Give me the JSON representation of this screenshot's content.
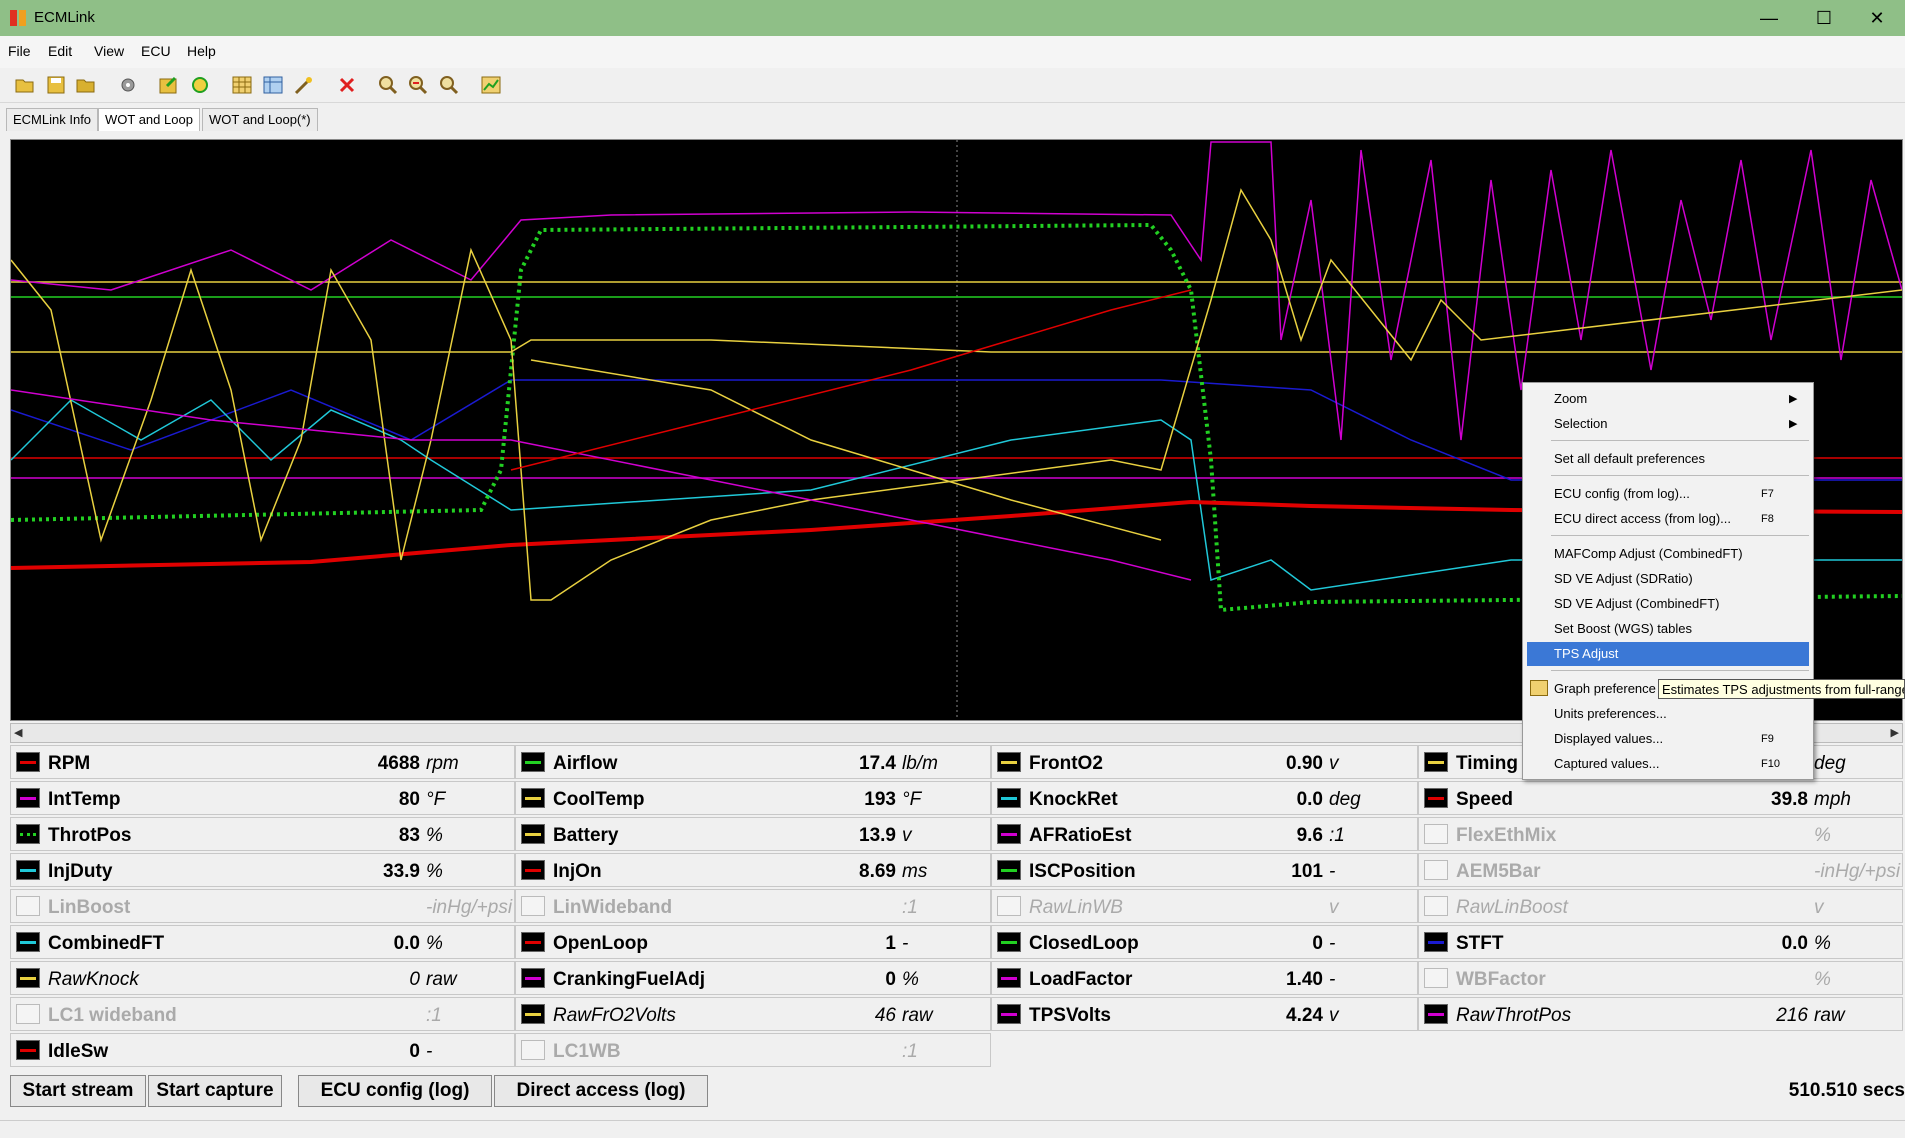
{
  "window": {
    "title": "ECMLink",
    "minimize": "—",
    "maximize": "☐",
    "close": "✕"
  },
  "menu": [
    "File",
    "Edit",
    "View",
    "ECU",
    "Help"
  ],
  "tabs": [
    "ECMLink Info",
    "WOT and Loop",
    "WOT and Loop(*)"
  ],
  "context_menu": {
    "zoom": "Zoom",
    "selection": "Selection",
    "set_defaults": "Set all default preferences",
    "ecu_config": "ECU config (from log)...",
    "ecu_config_key": "F7",
    "ecu_direct": "ECU direct access (from log)...",
    "ecu_direct_key": "F8",
    "mafcomp": "MAFComp Adjust (CombinedFT)",
    "sdve_ratio": "SD VE Adjust (SDRatio)",
    "sdve_combined": "SD VE Adjust (CombinedFT)",
    "set_boost": "Set Boost (WGS) tables",
    "tps_adjust": "TPS Adjust",
    "graph_prefs": "Graph preference",
    "units_prefs": "Units preferences...",
    "displayed_values": "Displayed values...",
    "displayed_values_key": "F9",
    "captured_values": "Captured values...",
    "captured_values_key": "F10",
    "tooltip": "Estimates TPS adjustments from full-range"
  },
  "colors": {
    "red": "#e00000",
    "magenta": "#d000d0",
    "green": "#22d022",
    "yellow": "#e8d040",
    "cyan": "#20c8d8",
    "blue": "#1a1ad0",
    "white": "#ffffff"
  },
  "values": [
    {
      "name": "RPM",
      "value": "4688",
      "unit": "rpm",
      "color": "red",
      "col": 0,
      "row": 0
    },
    {
      "name": "Airflow",
      "value": "17.4",
      "unit": "lb/m",
      "color": "green",
      "col": 1,
      "row": 0
    },
    {
      "name": "FrontO2",
      "value": "0.90",
      "unit": "v",
      "color": "yellow",
      "col": 2,
      "row": 0
    },
    {
      "name": "Timing",
      "value": "",
      "unit": "deg",
      "color": "yellow",
      "col": 3,
      "row": 0
    },
    {
      "name": "IntTemp",
      "value": "80",
      "unit": "°F",
      "color": "magenta",
      "col": 0,
      "row": 1
    },
    {
      "name": "CoolTemp",
      "value": "193",
      "unit": "°F",
      "color": "yellow",
      "col": 1,
      "row": 1
    },
    {
      "name": "KnockRet",
      "value": "0.0",
      "unit": "deg",
      "color": "cyan",
      "col": 2,
      "row": 1
    },
    {
      "name": "Speed",
      "value": "39.8",
      "unit": "mph",
      "color": "red",
      "col": 3,
      "row": 1
    },
    {
      "name": "ThrotPos",
      "value": "83",
      "unit": "%",
      "color": "green",
      "dotted": true,
      "col": 0,
      "row": 2
    },
    {
      "name": "Battery",
      "value": "13.9",
      "unit": "v",
      "color": "yellow",
      "col": 1,
      "row": 2
    },
    {
      "name": "AFRatioEst",
      "value": "9.6",
      "unit": ":1",
      "color": "magenta",
      "col": 2,
      "row": 2
    },
    {
      "name": "FlexEthMix",
      "value": "",
      "unit": "%",
      "off": true,
      "col": 3,
      "row": 2
    },
    {
      "name": "InjDuty",
      "value": "33.9",
      "unit": "%",
      "color": "cyan",
      "col": 0,
      "row": 3
    },
    {
      "name": "InjOn",
      "value": "8.69",
      "unit": "ms",
      "color": "red",
      "col": 1,
      "row": 3
    },
    {
      "name": "ISCPosition",
      "value": "101",
      "unit": "-",
      "color": "green",
      "col": 2,
      "row": 3
    },
    {
      "name": "AEM5Bar",
      "value": "",
      "unit": "-inHg/+psi",
      "off": true,
      "col": 3,
      "row": 3
    },
    {
      "name": "LinBoost",
      "value": "",
      "unit": "-inHg/+psi",
      "off": true,
      "col": 0,
      "row": 4
    },
    {
      "name": "LinWideband",
      "value": "",
      "unit": ":1",
      "off": true,
      "col": 1,
      "row": 4
    },
    {
      "name": "RawLinWB",
      "value": "",
      "unit": "v",
      "off": true,
      "italic": true,
      "col": 2,
      "row": 4
    },
    {
      "name": "RawLinBoost",
      "value": "",
      "unit": "v",
      "off": true,
      "italic": true,
      "col": 3,
      "row": 4
    },
    {
      "name": "CombinedFT",
      "value": "0.0",
      "unit": "%",
      "color": "cyan",
      "col": 0,
      "row": 5
    },
    {
      "name": "OpenLoop",
      "value": "1",
      "unit": "-",
      "color": "red",
      "col": 1,
      "row": 5
    },
    {
      "name": "ClosedLoop",
      "value": "0",
      "unit": "-",
      "color": "green",
      "col": 2,
      "row": 5
    },
    {
      "name": "STFT",
      "value": "0.0",
      "unit": "%",
      "color": "blue",
      "col": 3,
      "row": 5
    },
    {
      "name": "RawKnock",
      "value": "0",
      "unit": "raw",
      "color": "yellow",
      "italic": true,
      "col": 0,
      "row": 6
    },
    {
      "name": "CrankingFuelAdj",
      "value": "0",
      "unit": "%",
      "color": "magenta",
      "col": 1,
      "row": 6
    },
    {
      "name": "LoadFactor",
      "value": "1.40",
      "unit": "-",
      "color": "magenta",
      "col": 2,
      "row": 6
    },
    {
      "name": "WBFactor",
      "value": "",
      "unit": "%",
      "off": true,
      "col": 3,
      "row": 6
    },
    {
      "name": "LC1 wideband",
      "value": "",
      "unit": ":1",
      "off": true,
      "col": 0,
      "row": 7
    },
    {
      "name": "RawFrO2Volts",
      "value": "46",
      "unit": "raw",
      "color": "yellow",
      "italic": true,
      "col": 1,
      "row": 7
    },
    {
      "name": "TPSVolts",
      "value": "4.24",
      "unit": "v",
      "color": "magenta",
      "col": 2,
      "row": 7
    },
    {
      "name": "RawThrotPos",
      "value": "216",
      "unit": "raw",
      "color": "magenta",
      "italic": true,
      "col": 3,
      "row": 7
    },
    {
      "name": "IdleSw",
      "value": "0",
      "unit": "-",
      "color": "red",
      "col": 0,
      "row": 8
    },
    {
      "name": "LC1WB",
      "value": "",
      "unit": ":1",
      "off": true,
      "col": 1,
      "row": 8
    }
  ],
  "buttons": {
    "start_stream": "Start stream",
    "start_capture": "Start capture",
    "ecu_config_log": "ECU config (log)",
    "direct_access_log": "Direct access (log)"
  },
  "time": "510.510 secs"
}
